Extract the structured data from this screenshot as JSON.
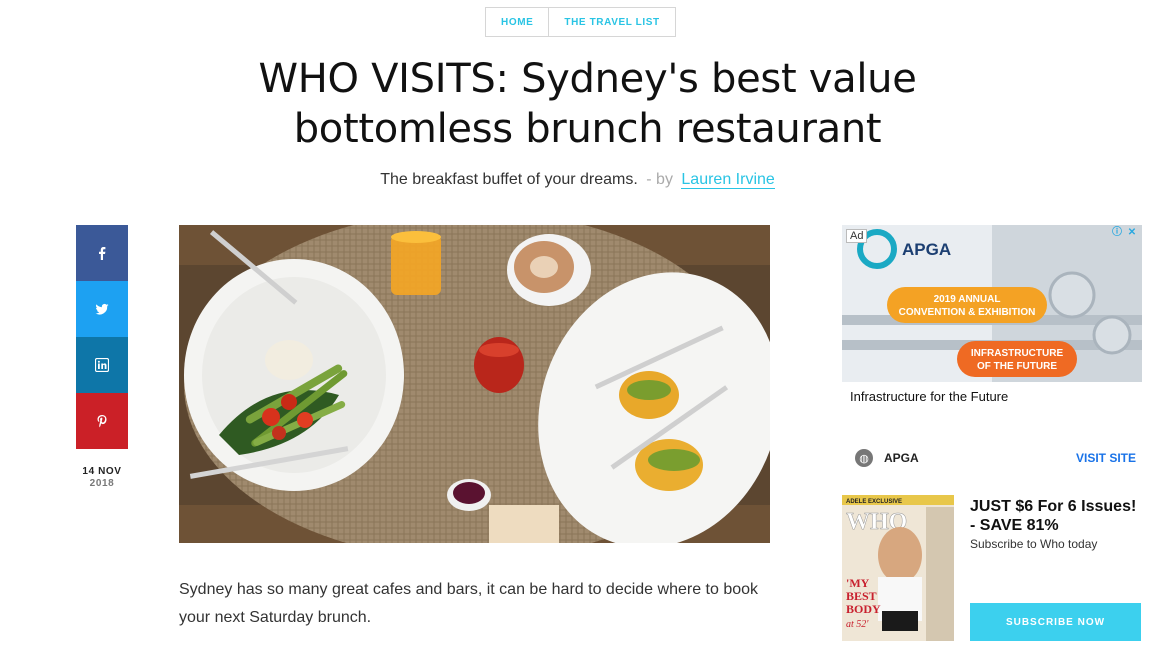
{
  "breadcrumb": {
    "home": "HOME",
    "section": "THE TRAVEL LIST"
  },
  "article": {
    "title_line1": "WHO VISITS: Sydney's best value",
    "title_line2": "bottomless brunch restaurant",
    "subtitle": "The breakfast buffet of your dreams.",
    "by_separator": "- by",
    "author": "Lauren Irvine",
    "date_day": "14 NOV",
    "date_year": "2018",
    "body": "Sydney has so many great cafes and bars, it can be hard to decide where to book your next Saturday brunch."
  },
  "share": [
    {
      "icon": "facebook-icon",
      "color": "#3b5998"
    },
    {
      "icon": "twitter-icon",
      "color": "#1da1f2"
    },
    {
      "icon": "linkedin-icon",
      "color": "#0e76a8"
    },
    {
      "icon": "pinterest-icon",
      "color": "#cb2027"
    }
  ],
  "ad": {
    "badge": "Ad",
    "logo": "APGA",
    "banner_line1": "2019 ANNUAL",
    "banner_line2": "CONVENTION & EXHIBITION",
    "banner_line3": "INFRASTRUCTURE",
    "banner_line4": "OF THE FUTURE",
    "headline": "Infrastructure for the Future",
    "brand": "APGA",
    "cta": "VISIT SITE"
  },
  "promo": {
    "headline": "JUST $6 For 6 Issues! - SAVE 81%",
    "sub": "Subscribe to Who today",
    "button": "SUBSCRIBE NOW",
    "cover_badge": "ADELE EXCLUSIVE",
    "cover_masthead": "WHO",
    "cover_line1": "'MY",
    "cover_line2": "BEST",
    "cover_line3": "BODY",
    "cover_line4": "at 52'"
  },
  "colors": {
    "accent": "#29c4e4",
    "subscribe": "#3cd0ee"
  }
}
